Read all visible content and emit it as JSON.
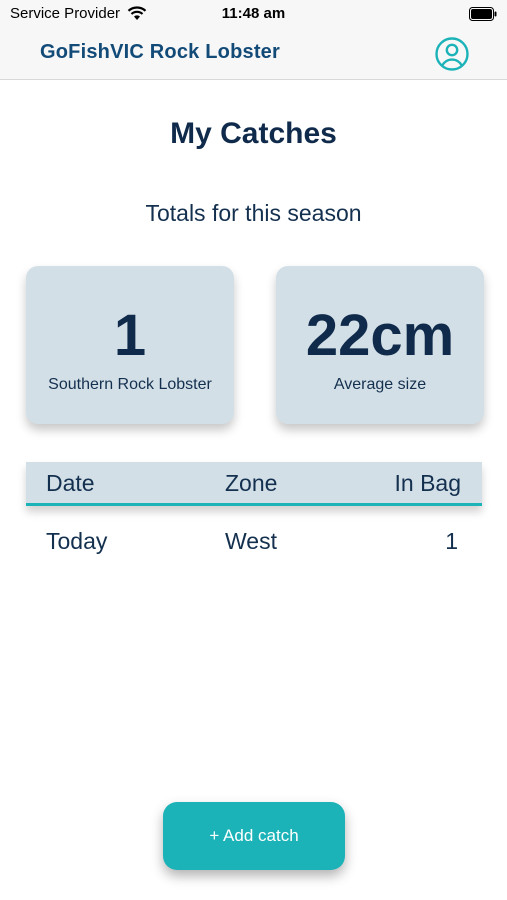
{
  "status_bar": {
    "carrier": "Service Provider",
    "time": "11:48 am",
    "wifi_icon": "wifi-icon",
    "battery_icon": "battery-icon"
  },
  "nav": {
    "title": "GoFishVIC Rock Lobster",
    "profile_icon": "user-circle-icon",
    "accent_color": "#1bb3b8",
    "title_color": "#124a78"
  },
  "main": {
    "title": "My Catches",
    "subtitle": "Totals for this season",
    "stats": [
      {
        "value": "1",
        "label": "Southern Rock Lobster"
      },
      {
        "value": "22cm",
        "label": "Average size"
      }
    ],
    "table": {
      "headers": [
        "Date",
        "Zone",
        "In Bag"
      ],
      "rows": [
        {
          "date": "Today",
          "zone": "West",
          "in_bag": "1"
        }
      ]
    }
  },
  "actions": {
    "add_catch_label": "+ Add catch",
    "button_color": "#1bb3b8"
  }
}
